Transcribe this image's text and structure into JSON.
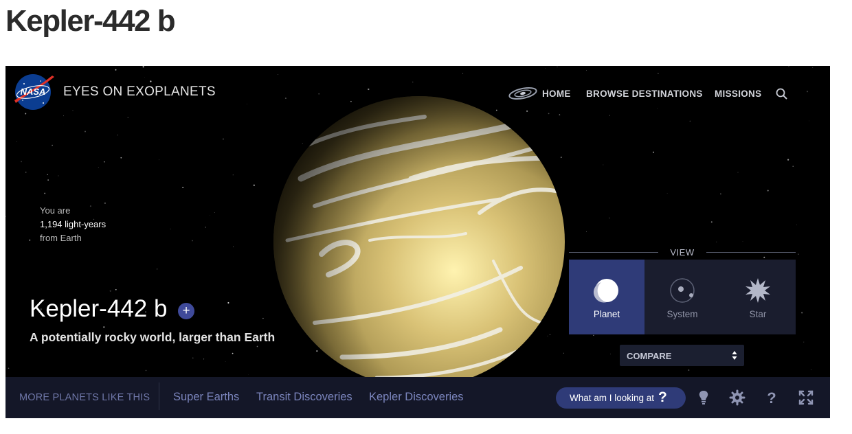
{
  "page": {
    "heading": "Kepler-442 b"
  },
  "header": {
    "app_title": "EYES ON EXOPLANETS",
    "logo_text": "NASA",
    "nav": {
      "home": "HOME",
      "browse": "BROWSE DESTINATIONS",
      "missions": "MISSIONS"
    }
  },
  "distance": {
    "prefix": "You are",
    "value": "1,194 light-years",
    "suffix": "from Earth"
  },
  "planet": {
    "name": "Kepler-442 b",
    "tagline": "A potentially rocky world, larger than Earth",
    "add_symbol": "+"
  },
  "view": {
    "label": "VIEW",
    "options": [
      {
        "label": "Planet",
        "icon": "planet-icon",
        "active": true
      },
      {
        "label": "System",
        "icon": "system-icon",
        "active": false
      },
      {
        "label": "Star",
        "icon": "star-icon",
        "active": false
      }
    ],
    "compare": "COMPARE"
  },
  "bottom": {
    "more_label": "MORE PLANETS LIKE THIS",
    "categories": [
      "Super Earths",
      "Transit Discoveries",
      "Kepler Discoveries"
    ],
    "help_pill": "What am I looking at",
    "help_pill_symbol": "?",
    "icons": [
      "lightbulb-icon",
      "settings-icon",
      "help-icon",
      "fullscreen-icon"
    ]
  },
  "colors": {
    "accent": "#2f3b78",
    "bar": "#141728",
    "link": "#7b85bd"
  }
}
